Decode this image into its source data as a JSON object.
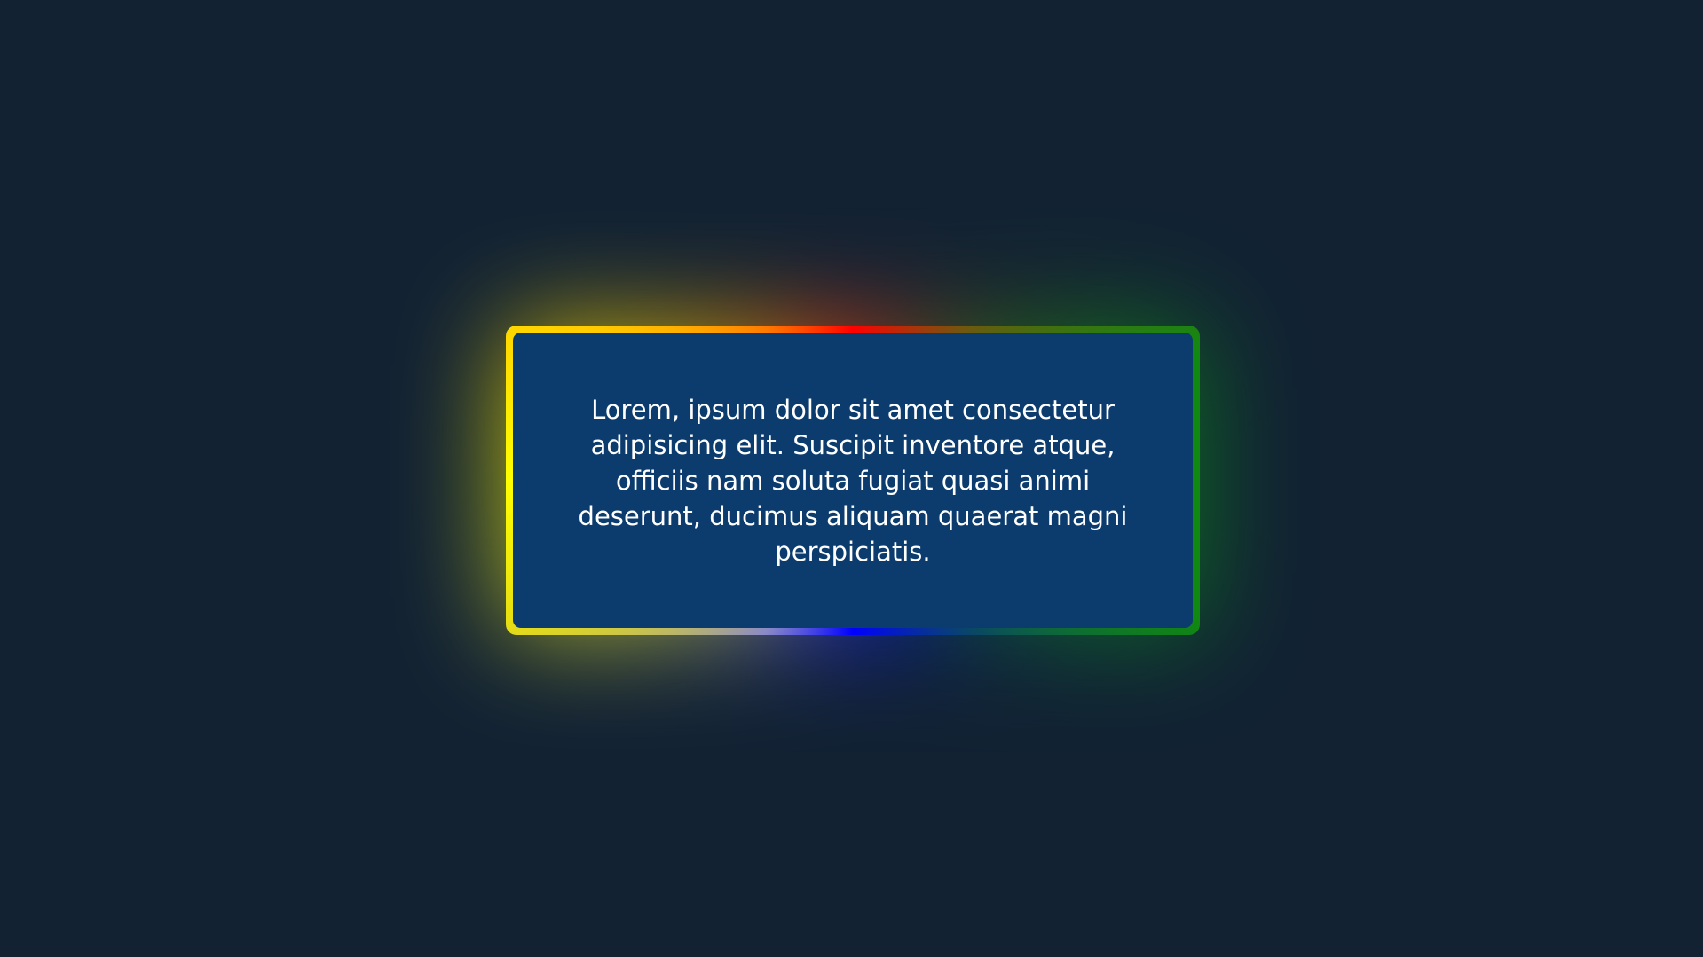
{
  "card": {
    "text": "Lorem, ipsum dolor sit amet consectetur adipisicing elit. Suscipit inventore atque, officiis nam soluta fugiat quasi animi deserunt, ducimus aliquam quaerat magni perspiciatis."
  },
  "colors": {
    "background": "#122233",
    "card_fill": "#0c3c6e",
    "text": "#ffffff",
    "border_gradient": [
      "#ff0000",
      "#118811",
      "#0000ff",
      "#ffff00",
      "#ff7a00"
    ]
  }
}
